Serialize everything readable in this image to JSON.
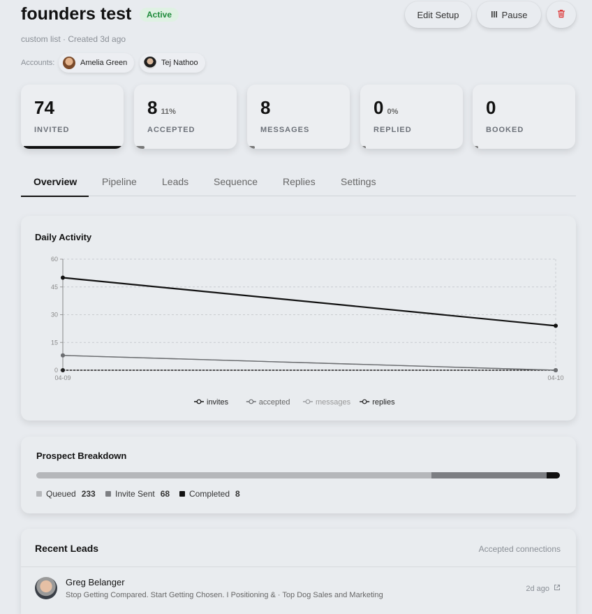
{
  "header": {
    "title": "founders test",
    "status": "Active",
    "subtitle": "custom list · Created 3d ago",
    "buttons": {
      "edit": "Edit Setup",
      "pause": "Pause"
    },
    "icons": {
      "pause": "pause-icon",
      "delete": "trash-icon"
    },
    "colors": {
      "status_bg": "#dff1e3",
      "status_text": "#1f8a3b",
      "delete": "#dd3333"
    }
  },
  "accounts": {
    "label": "Accounts:",
    "items": [
      {
        "name": "Amelia Green"
      },
      {
        "name": "Tej Nathoo"
      }
    ]
  },
  "stats": [
    {
      "value": "74",
      "pct": "",
      "label": "INVITED",
      "progress": 1.0
    },
    {
      "value": "8",
      "pct": "11%",
      "label": "ACCEPTED",
      "progress": 0.11
    },
    {
      "value": "8",
      "pct": "",
      "label": "MESSAGES",
      "progress": 0.08
    },
    {
      "value": "0",
      "pct": "0%",
      "label": "REPLIED",
      "progress": 0
    },
    {
      "value": "0",
      "pct": "",
      "label": "BOOKED",
      "progress": 0
    }
  ],
  "tabs": [
    {
      "label": "Overview",
      "active": true
    },
    {
      "label": "Pipeline",
      "active": false
    },
    {
      "label": "Leads",
      "active": false
    },
    {
      "label": "Sequence",
      "active": false
    },
    {
      "label": "Replies",
      "active": false
    },
    {
      "label": "Settings",
      "active": false
    }
  ],
  "activity": {
    "title": "Daily Activity"
  },
  "chart_data": {
    "type": "line",
    "title": "Daily Activity",
    "x": [
      "04-09",
      "04-10"
    ],
    "yticks": [
      0,
      15,
      30,
      45,
      60
    ],
    "ylim": [
      0,
      60
    ],
    "grid": true,
    "legend": "bottom",
    "series": [
      {
        "name": "invites",
        "values": [
          50,
          24
        ],
        "color": "#111111"
      },
      {
        "name": "accepted",
        "values": [
          8,
          0
        ],
        "color": "#6b6d70"
      },
      {
        "name": "messages",
        "values": [
          8,
          0
        ],
        "color": "#9a9c9f"
      },
      {
        "name": "replies",
        "values": [
          0,
          0
        ],
        "color": "#222222"
      }
    ]
  },
  "prospect": {
    "title": "Prospect Breakdown",
    "segments": [
      {
        "label": "Queued",
        "count": "233",
        "value": 233,
        "color": "#b5b7ba"
      },
      {
        "label": "Invite Sent",
        "count": "68",
        "value": 68,
        "color": "#7c7e82"
      },
      {
        "label": "Completed",
        "count": "8",
        "value": 8,
        "color": "#111111"
      }
    ]
  },
  "leads": {
    "title": "Recent Leads",
    "subtitle": "Accepted connections",
    "items": [
      {
        "name": "Greg Belanger",
        "description": "Stop Getting Compared. Start Getting Chosen. I Positioning & · Top Dog Sales and Marketing",
        "time": "2d ago",
        "icon": "external-link-icon"
      }
    ]
  }
}
